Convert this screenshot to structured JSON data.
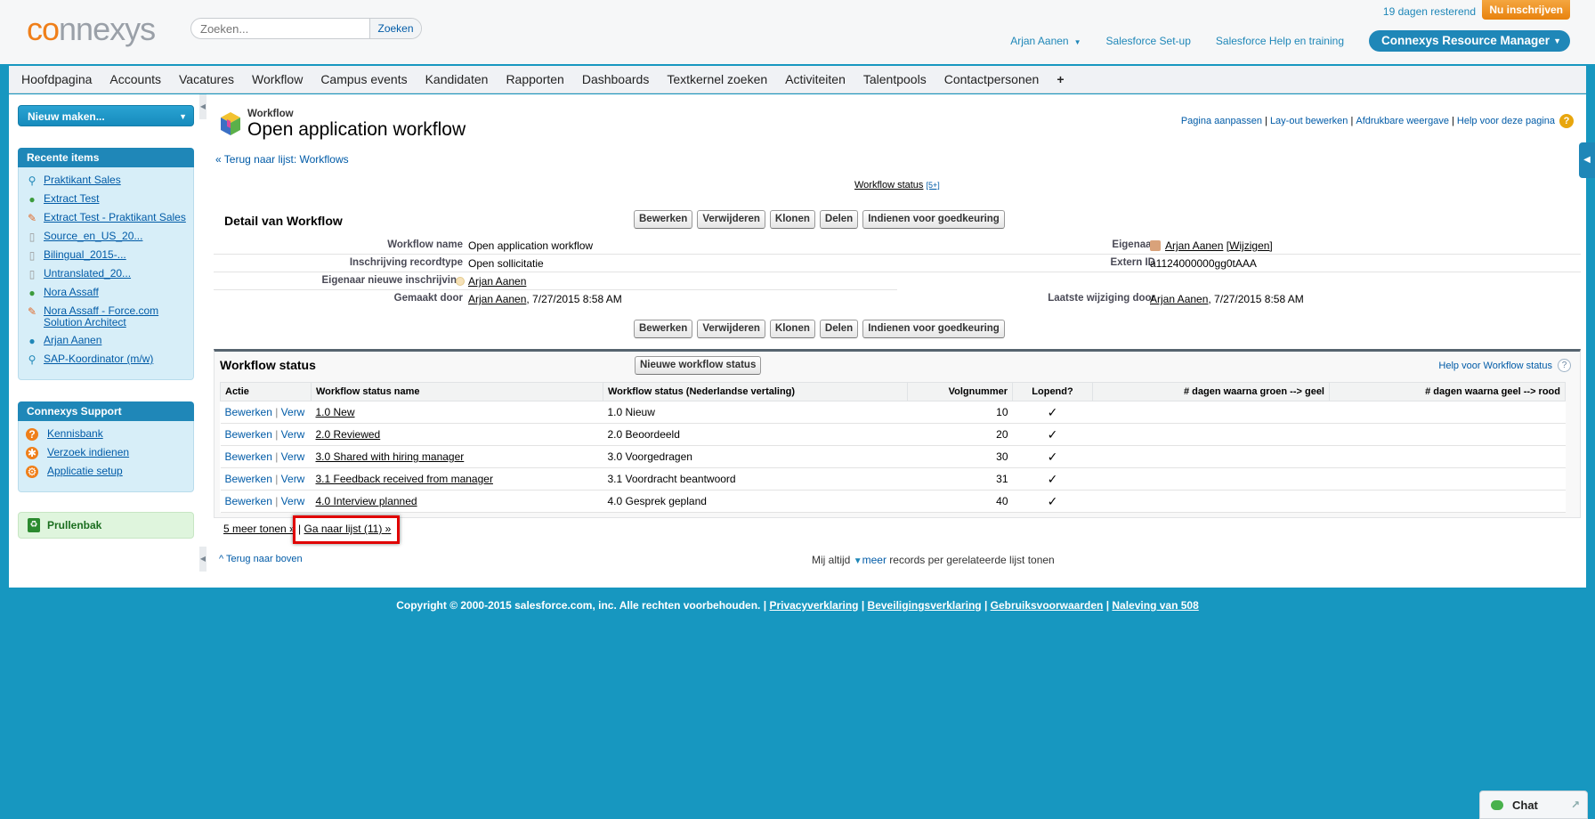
{
  "header": {
    "logo_prefix": "co",
    "logo_suffix": "nnexys",
    "search_placeholder": "Zoeken...",
    "search_button": "Zoeken",
    "trial_text": "19 dagen resterend",
    "subscribe_label": "Nu inschrijven",
    "user_name": "Arjan Aanen",
    "setup_link": "Salesforce Set-up",
    "help_link": "Salesforce Help en training",
    "app_menu": "Connexys Resource Manager"
  },
  "nav": {
    "tabs": [
      "Hoofdpagina",
      "Accounts",
      "Vacatures",
      "Workflow",
      "Campus events",
      "Kandidaten",
      "Rapporten",
      "Dashboards",
      "Textkernel zoeken",
      "Activiteiten",
      "Talentpools",
      "Contactpersonen"
    ],
    "plus": "+"
  },
  "sidebar": {
    "new_button": "Nieuw maken...",
    "recent_title": "Recente items",
    "recent_items": [
      {
        "label": "Praktikant Sales",
        "icon": "magnifier-icon"
      },
      {
        "label": "Extract Test",
        "icon": "person-icon"
      },
      {
        "label": "Extract Test - Praktikant Sales",
        "icon": "pencil-icon"
      },
      {
        "label": "Source_en_US_20...",
        "icon": "document-icon"
      },
      {
        "label": "Bilingual_2015-...",
        "icon": "document-icon"
      },
      {
        "label": "Untranslated_20...",
        "icon": "document-icon"
      },
      {
        "label": "Nora Assaff",
        "icon": "person-icon"
      },
      {
        "label": "Nora Assaff - Force.com Solution Architect",
        "icon": "pencil-icon"
      },
      {
        "label": "Arjan Aanen",
        "icon": "user-icon"
      },
      {
        "label": "SAP-Koordinator (m/w)",
        "icon": "magnifier-icon"
      }
    ],
    "support_title": "Connexys Support",
    "support_items": [
      "Kennisbank",
      "Verzoek indienen",
      "Applicatie setup"
    ],
    "trash_label": "Prullenbak"
  },
  "page": {
    "object_type": "Workflow",
    "title": "Open application workflow",
    "back_link": "« Terug naar lijst: Workflows",
    "help_links": [
      "Pagina aanpassen",
      "Lay-out bewerken",
      "Afdrukbare weergave",
      "Help voor deze pagina"
    ],
    "status_link": "Workflow status",
    "status_count": "[5+]"
  },
  "detail": {
    "title": "Detail van Workflow",
    "buttons": [
      "Bewerken",
      "Verwijderen",
      "Klonen",
      "Delen",
      "Indienen voor goedkeuring"
    ],
    "fields": {
      "workflow_name_label": "Workflow name",
      "workflow_name_value": "Open application workflow",
      "record_type_label": "Inschrijving recordtype",
      "record_type_value": "Open sollicitatie",
      "new_owner_label": "Eigenaar nieuwe inschrijving",
      "new_owner_value": "Arjan Aanen",
      "created_label": "Gemaakt door",
      "created_user": "Arjan Aanen",
      "created_date": ", 7/27/2015 8:58 AM",
      "owner_label": "Eigenaar",
      "owner_value": "Arjan Aanen",
      "owner_change": "[Wijzigen]",
      "extern_label": "Extern ID",
      "extern_value": "a1124000000gg0tAAA",
      "modified_label": "Laatste wijziging door",
      "modified_user": "Arjan Aanen",
      "modified_date": ", 7/27/2015 8:58 AM"
    }
  },
  "related": {
    "title": "Workflow status",
    "new_button": "Nieuwe workflow status",
    "help": "Help voor Workflow status",
    "columns": [
      "Actie",
      "Workflow status name",
      "Workflow status (Nederlandse vertaling)",
      "Volgnummer",
      "Lopend?",
      "# dagen waarna groen --> geel",
      "# dagen waarna geel --> rood"
    ],
    "rows": [
      {
        "edit": "Bewerken",
        "sep": " | ",
        "del": "Verw",
        "name": "1.0 New",
        "nl": "1.0 Nieuw",
        "seq": "10",
        "check": "✓"
      },
      {
        "edit": "Bewerken",
        "sep": " | ",
        "del": "Verw",
        "name": "2.0 Reviewed",
        "nl": "2.0 Beoordeeld",
        "seq": "20",
        "check": "✓"
      },
      {
        "edit": "Bewerken",
        "sep": " | ",
        "del": "Verw",
        "name": "3.0 Shared with hiring manager",
        "nl": "3.0 Voorgedragen",
        "seq": "30",
        "check": "✓"
      },
      {
        "edit": "Bewerken",
        "sep": " | ",
        "del": "Verw",
        "name": "3.1 Feedback received from manager",
        "nl": "3.1 Voordracht beantwoord",
        "seq": "31",
        "check": "✓"
      },
      {
        "edit": "Bewerken",
        "sep": " | ",
        "del": "Verw",
        "name": "4.0 Interview planned",
        "nl": "4.0 Gesprek gepland",
        "seq": "40",
        "check": "✓"
      }
    ],
    "show_more": "5 meer tonen »",
    "pipe": " | ",
    "go_to_list": "Ga naar lijst (11) »"
  },
  "bottom": {
    "back_top": "Terug naar boven",
    "always_prefix": "Mij altijd",
    "always_more": "meer",
    "always_suffix": "records per gerelateerde lijst tonen"
  },
  "footer": {
    "copyright": "Copyright © 2000-2015 salesforce.com, inc. Alle rechten voorbehouden. |",
    "links": [
      "Privacyverklaring",
      "Beveiligingsverklaring",
      "Gebruiksvoorwaarden",
      "Naleving van 508"
    ]
  },
  "chat": {
    "label": "Chat"
  },
  "colors": {
    "background": "#1797c0",
    "accent": "#1f87b8",
    "link": "#015ba7",
    "subscribe": "#e8820d",
    "highlight": "#e00000"
  }
}
